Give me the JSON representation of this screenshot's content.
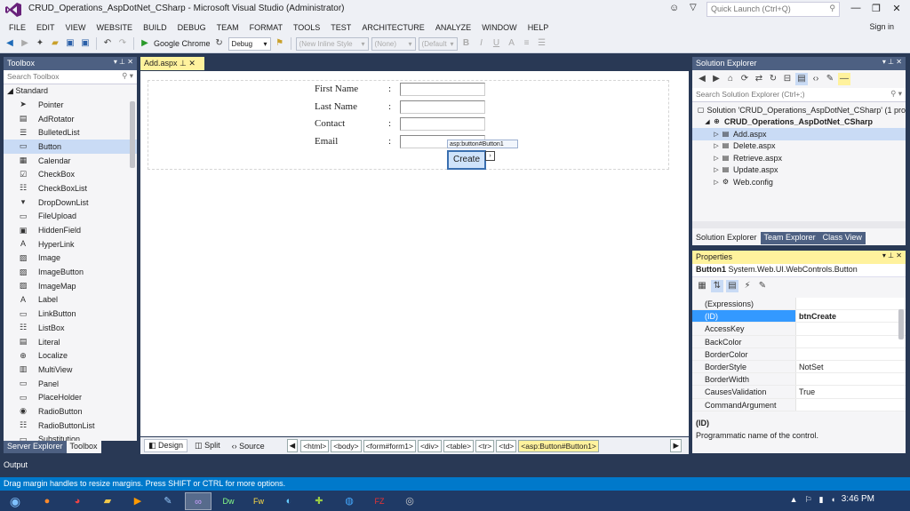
{
  "window": {
    "title": "CRUD_Operations_AspDotNet_CSharp - Microsoft Visual Studio (Administrator)",
    "quick_launch_placeholder": "Quick Launch (Ctrl+Q)",
    "sign_in": "Sign in"
  },
  "menu": [
    "FILE",
    "EDIT",
    "VIEW",
    "WEBSITE",
    "BUILD",
    "DEBUG",
    "TEAM",
    "FORMAT",
    "TOOLS",
    "TEST",
    "ARCHITECTURE",
    "ANALYZE",
    "WINDOW",
    "HELP"
  ],
  "toolbar": {
    "browser": "Google Chrome",
    "config": "Debug",
    "style": "(New Inline Style",
    "target": "(None)",
    "font": "(Default"
  },
  "toolbox": {
    "title": "Toolbox",
    "search_placeholder": "Search Toolbox",
    "group": "Standard",
    "items": [
      {
        "label": "Pointer",
        "icon": "➤"
      },
      {
        "label": "AdRotator",
        "icon": "▤"
      },
      {
        "label": "BulletedList",
        "icon": "☰"
      },
      {
        "label": "Button",
        "icon": "▭"
      },
      {
        "label": "Calendar",
        "icon": "▦"
      },
      {
        "label": "CheckBox",
        "icon": "☑"
      },
      {
        "label": "CheckBoxList",
        "icon": "☷"
      },
      {
        "label": "DropDownList",
        "icon": "▾"
      },
      {
        "label": "FileUpload",
        "icon": "▭"
      },
      {
        "label": "HiddenField",
        "icon": "▣"
      },
      {
        "label": "HyperLink",
        "icon": "A"
      },
      {
        "label": "Image",
        "icon": "▨"
      },
      {
        "label": "ImageButton",
        "icon": "▨"
      },
      {
        "label": "ImageMap",
        "icon": "▨"
      },
      {
        "label": "Label",
        "icon": "A"
      },
      {
        "label": "LinkButton",
        "icon": "▭"
      },
      {
        "label": "ListBox",
        "icon": "☷"
      },
      {
        "label": "Literal",
        "icon": "▤"
      },
      {
        "label": "Localize",
        "icon": "⊕"
      },
      {
        "label": "MultiView",
        "icon": "▥"
      },
      {
        "label": "Panel",
        "icon": "▭"
      },
      {
        "label": "PlaceHolder",
        "icon": "▭"
      },
      {
        "label": "RadioButton",
        "icon": "◉"
      },
      {
        "label": "RadioButtonList",
        "icon": "☷"
      },
      {
        "label": "Substitution",
        "icon": "▭"
      }
    ],
    "tabs": [
      "Server Explorer",
      "Toolbox"
    ]
  },
  "document": {
    "tab": "Add.aspx",
    "form_labels": [
      "First Name",
      "Last Name",
      "Contact",
      "Email"
    ],
    "colon": ":",
    "smart_tag": "asp:button#Button1",
    "create_button": "Create",
    "views": [
      "Design",
      "Split",
      "Source"
    ],
    "breadcrumbs": [
      "<html>",
      "<body>",
      "<form#form1>",
      "<div>",
      "<table>",
      "<tr>",
      "<td>",
      "<asp:Button#Button1>"
    ]
  },
  "solution_explorer": {
    "title": "Solution Explorer",
    "search_placeholder": "Search Solution Explorer (Ctrl+;)",
    "solution": "Solution 'CRUD_Operations_AspDotNet_CSharp' (1 pro",
    "project": "CRUD_Operations_AspDotNet_CSharp",
    "files": [
      "Add.aspx",
      "Delete.aspx",
      "Retrieve.aspx",
      "Update.aspx",
      "Web.config"
    ],
    "tabs": [
      "Solution Explorer",
      "Team Explorer",
      "Class View"
    ]
  },
  "properties": {
    "title": "Properties",
    "object": "Button1",
    "object_type": "System.Web.UI.WebControls.Button",
    "rows": [
      {
        "name": "(Expressions)",
        "value": ""
      },
      {
        "name": "(ID)",
        "value": "btnCreate"
      },
      {
        "name": "AccessKey",
        "value": ""
      },
      {
        "name": "BackColor",
        "value": ""
      },
      {
        "name": "BorderColor",
        "value": ""
      },
      {
        "name": "BorderStyle",
        "value": "NotSet"
      },
      {
        "name": "BorderWidth",
        "value": ""
      },
      {
        "name": "CausesValidation",
        "value": "True"
      },
      {
        "name": "CommandArgument",
        "value": ""
      }
    ],
    "desc_title": "(ID)",
    "desc_text": "Programmatic name of the control."
  },
  "output": "Output",
  "status": "Drag margin handles to resize margins. Press SHIFT or CTRL for more options.",
  "clock": "3:46 PM",
  "colors": {
    "accent": "#0079cb",
    "pane": "#293955",
    "active_tab": "#fff29d",
    "selection": "#3399ff"
  }
}
